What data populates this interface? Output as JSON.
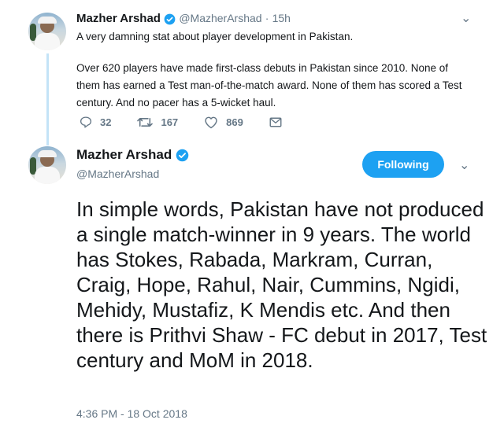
{
  "tweet1": {
    "name": "Mazher Arshad",
    "handle": "@MazherArshad",
    "time": "15h",
    "text_line1": "A very damning stat about player development in Pakistan.",
    "text_body": "Over 620 players have made first-class debuts in Pakistan since 2010. None of them has earned a Test man-of-the-match award. None of them has scored a Test century. And no pacer has a 5-wicket haul.",
    "replies": "32",
    "retweets": "167",
    "likes": "869"
  },
  "tweet2": {
    "name": "Mazher Arshad",
    "handle": "@MazherArshad",
    "follow_label": "Following",
    "text": "In simple words, Pakistan have not produced a single match-winner in 9 years. The world has Stokes, Rabada, Markram, Curran, Craig, Hope, Rahul, Nair, Cummins, Ngidi, Mehidy, Mustafiz, K Mendis etc. And then there is Prithvi Shaw - FC debut in 2017, Test century and MoM in 2018.",
    "timestamp": "4:36 PM - 18 Oct 2018"
  },
  "separator": "·",
  "chevron": "⌄",
  "colors": {
    "accent": "#1da1f2",
    "muted": "#657786",
    "thread": "#c4e3f7"
  },
  "icons": [
    "verified-badge-icon",
    "reply-icon",
    "retweet-icon",
    "like-icon",
    "message-icon",
    "chevron-down-icon"
  ]
}
